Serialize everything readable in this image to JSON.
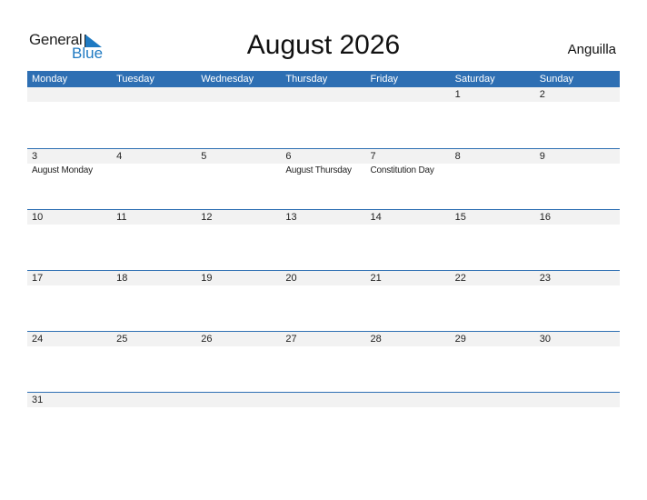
{
  "logo": {
    "word1": "General",
    "word2": "Blue"
  },
  "header": {
    "title": "August 2026",
    "country": "Anguilla"
  },
  "colors": {
    "accent": "#2e6fb3",
    "date_strip": "#f2f2f2",
    "logo_blue": "#1f7ac2"
  },
  "weekdays": [
    "Monday",
    "Tuesday",
    "Wednesday",
    "Thursday",
    "Friday",
    "Saturday",
    "Sunday"
  ],
  "weeks": [
    {
      "dates": [
        "",
        "",
        "",
        "",
        "",
        "1",
        "2"
      ],
      "events": [
        "",
        "",
        "",
        "",
        "",
        "",
        ""
      ]
    },
    {
      "dates": [
        "3",
        "4",
        "5",
        "6",
        "7",
        "8",
        "9"
      ],
      "events": [
        "August Monday",
        "",
        "",
        "August Thursday",
        "Constitution Day",
        "",
        ""
      ]
    },
    {
      "dates": [
        "10",
        "11",
        "12",
        "13",
        "14",
        "15",
        "16"
      ],
      "events": [
        "",
        "",
        "",
        "",
        "",
        "",
        ""
      ]
    },
    {
      "dates": [
        "17",
        "18",
        "19",
        "20",
        "21",
        "22",
        "23"
      ],
      "events": [
        "",
        "",
        "",
        "",
        "",
        "",
        ""
      ]
    },
    {
      "dates": [
        "24",
        "25",
        "26",
        "27",
        "28",
        "29",
        "30"
      ],
      "events": [
        "",
        "",
        "",
        "",
        "",
        "",
        ""
      ]
    },
    {
      "dates": [
        "31",
        "",
        "",
        "",
        "",
        "",
        ""
      ],
      "events": [
        "",
        "",
        "",
        "",
        "",
        "",
        ""
      ]
    }
  ]
}
